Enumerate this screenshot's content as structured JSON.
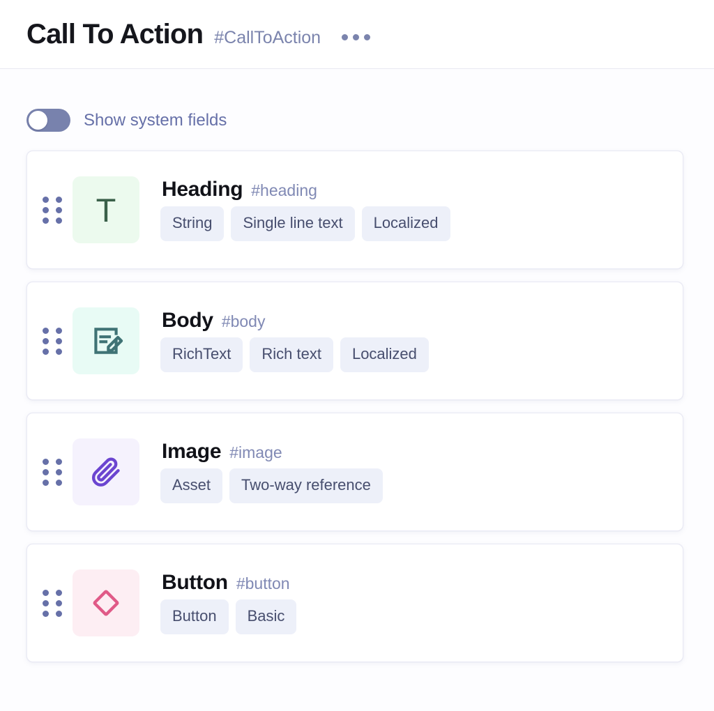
{
  "header": {
    "title": "Call To Action",
    "slug": "#CallToAction",
    "menu_icon": "kebab-menu-icon",
    "menu_label": "More actions"
  },
  "toolbar": {
    "system_fields_toggle": {
      "label": "Show system fields",
      "state": "off"
    }
  },
  "colors": {
    "page_background": "#fdfdff",
    "card_background": "#ffffff",
    "card_border": "#eaeaf5",
    "slug_text": "#7b84ad",
    "toggle_track": "#7882ad",
    "toggle_knob": "#ffffff",
    "tag_background": "#edf0f9",
    "tag_text": "#474e6e",
    "title_text": "#15161c",
    "divider": "#e8e8f2"
  },
  "fields": [
    {
      "name": "Heading",
      "slug": "#heading",
      "icon": "text-type-icon",
      "icon_glyph": "T",
      "icon_box_color": "#ecfaee",
      "icon_color": "#3a6049",
      "tags": [
        "String",
        "Single line text",
        "Localized"
      ]
    },
    {
      "name": "Body",
      "slug": "#body",
      "icon": "rich-text-document-edit-icon",
      "icon_glyph": "",
      "icon_box_color": "#e8fbf5",
      "icon_color": "#3f7375",
      "tags": [
        "RichText",
        "Rich text",
        "Localized"
      ]
    },
    {
      "name": "Image",
      "slug": "#image",
      "icon": "paperclip-attachment-icon",
      "icon_glyph": "",
      "icon_box_color": "#f5f2fd",
      "icon_color": "#6b45d0",
      "tags": [
        "Asset",
        "Two-way reference"
      ]
    },
    {
      "name": "Button",
      "slug": "#button",
      "icon": "diamond-component-icon",
      "icon_glyph": "",
      "icon_box_color": "#fdeef3",
      "icon_color": "#e05a87",
      "tags": [
        "Button",
        "Basic"
      ]
    }
  ],
  "drag_handle": {
    "icon": "drag-handle-dots-icon",
    "label": "Reorder field"
  }
}
